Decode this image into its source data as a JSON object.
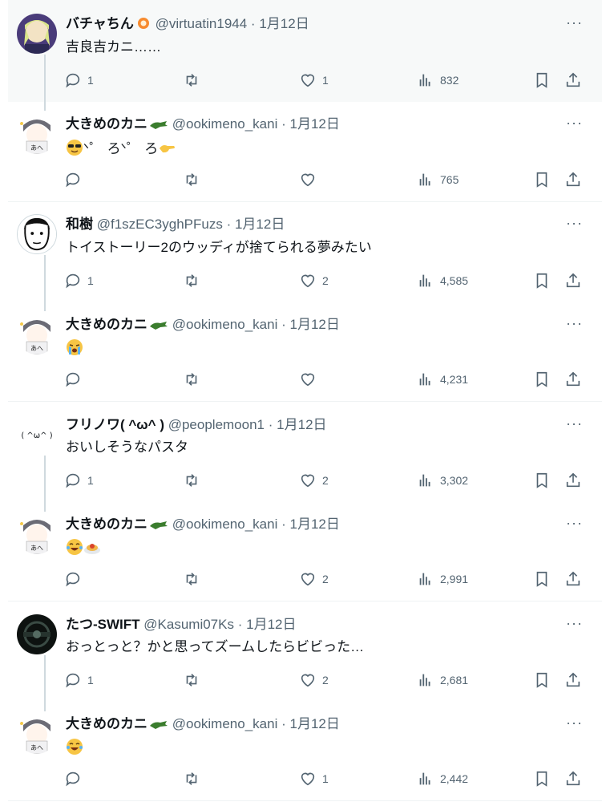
{
  "posts": [
    {
      "name": "バチャちん",
      "handle": "@virtuatin1944",
      "date": "1月12日",
      "text": "吉良吉カニ……",
      "reply_count": "1",
      "like_count": "1",
      "views": "832"
    },
    {
      "name": "大きめのカニ",
      "handle": "@ookimeno_kani",
      "date": "1月12日",
      "text": "ᐠ゜ ろᐠ゜ ろ",
      "reply_count": "",
      "like_count": "",
      "views": "765"
    },
    {
      "name": "和樹",
      "handle": "@f1szEC3yghPFuzs",
      "date": "1月12日",
      "text": "トイストーリー2のウッディが捨てられる夢みたい",
      "reply_count": "1",
      "like_count": "2",
      "views": "4,585"
    },
    {
      "name": "大きめのカニ",
      "handle": "@ookimeno_kani",
      "date": "1月12日",
      "text": "",
      "reply_count": "",
      "like_count": "",
      "views": "4,231"
    },
    {
      "name": "フリノワ( ^ω^ )",
      "handle": "@peoplemoon1",
      "date": "1月12日",
      "text": "おいしそうなパスタ",
      "avatar_text": "( ^ω^ )",
      "reply_count": "1",
      "like_count": "2",
      "views": "3,302"
    },
    {
      "name": "大きめのカニ",
      "handle": "@ookimeno_kani",
      "date": "1月12日",
      "text": "",
      "reply_count": "",
      "like_count": "2",
      "views": "2,991"
    },
    {
      "name": "たつ-SWIFT",
      "handle": "@Kasumi07Ks",
      "date": "1月12日",
      "text": "おっとっと？かと思ってズームしたらビビった…",
      "reply_count": "1",
      "like_count": "2",
      "views": "2,681"
    },
    {
      "name": "大きめのカニ",
      "handle": "@ookimeno_kani",
      "date": "1月12日",
      "text": "",
      "reply_count": "",
      "like_count": "1",
      "views": "2,442"
    }
  ],
  "separator": "·",
  "more_label": "···",
  "colors": {
    "text_primary": "#0f1419",
    "text_secondary": "#536471",
    "highlight_bg": "#f7f9f9",
    "thread_line": "#cfd9de",
    "separator": "#eff3f4"
  },
  "icons": [
    "reply-icon",
    "retweet-icon",
    "like-icon",
    "views-icon",
    "bookmark-icon",
    "share-icon",
    "more-icon"
  ]
}
